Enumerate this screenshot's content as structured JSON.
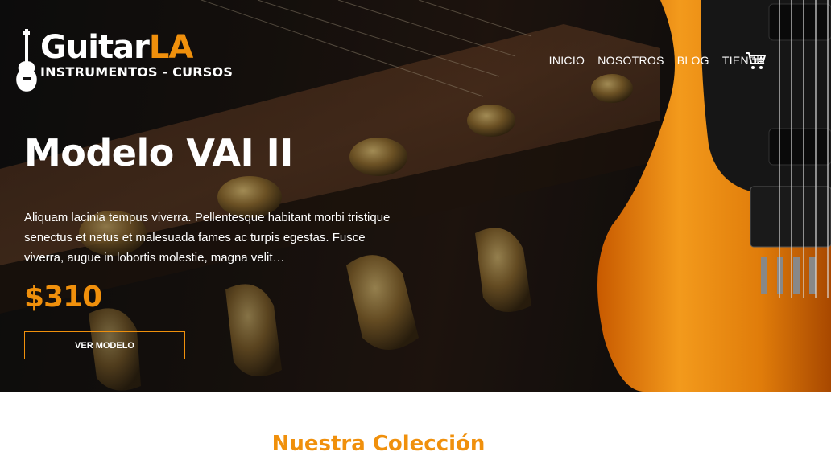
{
  "header": {
    "logo": {
      "brand_main": "Guitar",
      "brand_accent": "LA",
      "tagline": "INSTRUMENTOS - CURSOS"
    },
    "nav": [
      "INICIO",
      "NOSOTROS",
      "BLOG",
      "TIENDA"
    ],
    "cart_icon": "cart-icon"
  },
  "hero": {
    "title": "Modelo VAI II",
    "description": "Aliquam lacinia tempus viverra. Pellentesque habitant morbi tristique senectus et netus et malesuada fames ac turpis egestas. Fusce viverra, augue in lobortis molestie, magna velit…",
    "price": "$310",
    "button_label": "VER MODELO"
  },
  "collection": {
    "title": "Nuestra Colección"
  },
  "colors": {
    "accent": "#f0900c",
    "hero_bg": "#141212",
    "text_light": "#ffffff"
  }
}
